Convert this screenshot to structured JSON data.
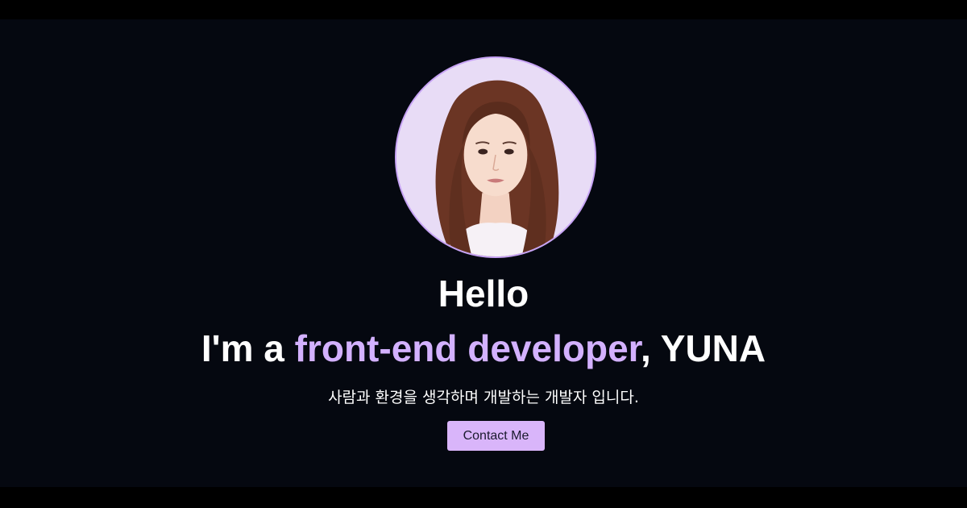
{
  "hero": {
    "greeting": "Hello",
    "intro_prefix": "I'm a ",
    "intro_highlight": "front-end developer",
    "intro_suffix": ", YUNA",
    "tagline": "사람과 환경을 생각하며 개발하는 개발자 입니다.",
    "contact_button_label": "Contact Me"
  },
  "colors": {
    "background": "#050810",
    "accent": "#d3b1ff",
    "button_bg": "#d9b5fa",
    "avatar_border": "#c7a3f5"
  },
  "icons": {
    "avatar": "profile-photo"
  }
}
